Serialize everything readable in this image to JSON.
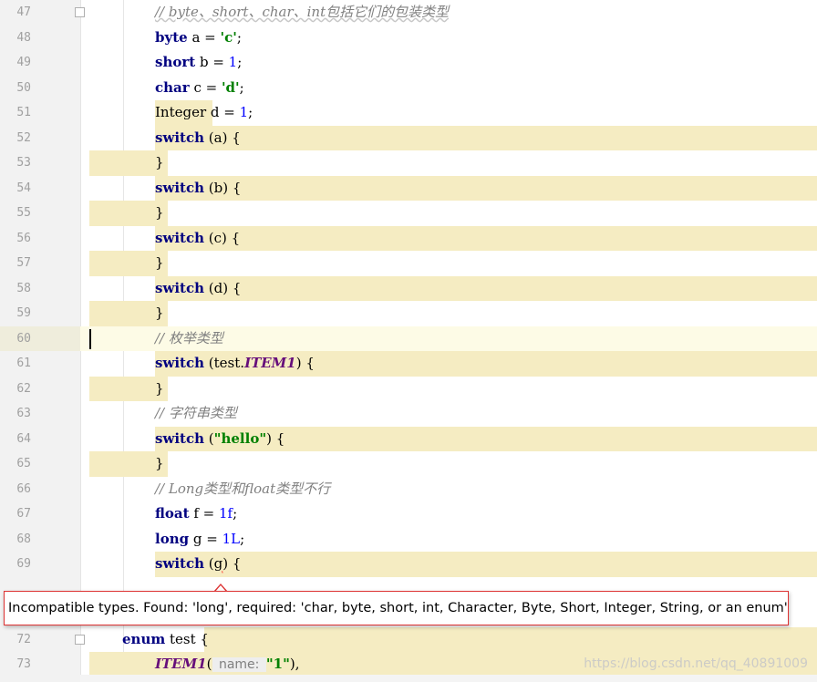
{
  "editor": {
    "lines": [
      {
        "num": "47",
        "tokens": [
          {
            "t": "// byte、short、char、int包括它们的包装类型",
            "c": "cm cm-u"
          }
        ]
      },
      {
        "num": "48",
        "tokens": [
          {
            "t": "byte",
            "c": "kw"
          },
          {
            "t": " a = ",
            "c": ""
          },
          {
            "t": "'c'",
            "c": "str"
          },
          {
            "t": ";",
            "c": ""
          }
        ]
      },
      {
        "num": "49",
        "tokens": [
          {
            "t": "short",
            "c": "kw"
          },
          {
            "t": " b = ",
            "c": ""
          },
          {
            "t": "1",
            "c": "num"
          },
          {
            "t": ";",
            "c": ""
          }
        ]
      },
      {
        "num": "50",
        "tokens": [
          {
            "t": "char",
            "c": "kw"
          },
          {
            "t": " c = ",
            "c": ""
          },
          {
            "t": "'d'",
            "c": "str"
          },
          {
            "t": ";",
            "c": ""
          }
        ]
      },
      {
        "num": "51",
        "tokens": [
          {
            "t": "Integer",
            "c": ""
          },
          {
            "t": " d = ",
            "c": ""
          },
          {
            "t": "1",
            "c": "num"
          },
          {
            "t": ";",
            "c": ""
          }
        ]
      },
      {
        "num": "52",
        "tokens": [
          {
            "t": "switch",
            "c": "kw"
          },
          {
            "t": " (a) {",
            "c": ""
          }
        ]
      },
      {
        "num": "53",
        "tokens": [
          {
            "t": "}",
            "c": ""
          }
        ]
      },
      {
        "num": "54",
        "tokens": [
          {
            "t": "switch",
            "c": "kw"
          },
          {
            "t": " (b) {",
            "c": ""
          }
        ]
      },
      {
        "num": "55",
        "tokens": [
          {
            "t": "}",
            "c": ""
          }
        ]
      },
      {
        "num": "56",
        "tokens": [
          {
            "t": "switch",
            "c": "kw"
          },
          {
            "t": " (c) {",
            "c": ""
          }
        ]
      },
      {
        "num": "57",
        "tokens": [
          {
            "t": "}",
            "c": ""
          }
        ]
      },
      {
        "num": "58",
        "tokens": [
          {
            "t": "switch",
            "c": "kw"
          },
          {
            "t": " (d) {",
            "c": ""
          }
        ]
      },
      {
        "num": "59",
        "tokens": [
          {
            "t": "}",
            "c": ""
          }
        ]
      },
      {
        "num": "60",
        "tokens": [
          {
            "t": "// 枚举类型",
            "c": "cm"
          }
        ]
      },
      {
        "num": "61",
        "tokens": [
          {
            "t": "switch",
            "c": "kw"
          },
          {
            "t": " (test.",
            "c": ""
          },
          {
            "t": "ITEM1",
            "c": "const"
          },
          {
            "t": ") {",
            "c": ""
          }
        ]
      },
      {
        "num": "62",
        "tokens": [
          {
            "t": "}",
            "c": ""
          }
        ]
      },
      {
        "num": "63",
        "tokens": [
          {
            "t": "// 字符串类型",
            "c": "cm"
          }
        ]
      },
      {
        "num": "64",
        "tokens": [
          {
            "t": "switch",
            "c": "kw"
          },
          {
            "t": " (",
            "c": ""
          },
          {
            "t": "\"hello\"",
            "c": "str"
          },
          {
            "t": ") {",
            "c": ""
          }
        ]
      },
      {
        "num": "65",
        "tokens": [
          {
            "t": "}",
            "c": ""
          }
        ]
      },
      {
        "num": "66",
        "tokens": [
          {
            "t": "// Long类型和float类型不行",
            "c": "cm"
          }
        ]
      },
      {
        "num": "67",
        "tokens": [
          {
            "t": "float",
            "c": "kw"
          },
          {
            "t": " f = ",
            "c": ""
          },
          {
            "t": "1f",
            "c": "num"
          },
          {
            "t": ";",
            "c": ""
          }
        ]
      },
      {
        "num": "68",
        "tokens": [
          {
            "t": "long",
            "c": "kw"
          },
          {
            "t": " g = ",
            "c": ""
          },
          {
            "t": "1L",
            "c": "num"
          },
          {
            "t": ";",
            "c": ""
          }
        ]
      },
      {
        "num": "69",
        "tokens": [
          {
            "t": "switch",
            "c": "kw"
          },
          {
            "t": " (",
            "c": ""
          },
          {
            "t": "g",
            "c": "var-err"
          },
          {
            "t": ") {",
            "c": ""
          }
        ]
      },
      {
        "num": "72",
        "tokens": [
          {
            "t": "enum",
            "c": "kw"
          },
          {
            "t": " test {",
            "c": ""
          }
        ]
      },
      {
        "num": "73",
        "tokens": [
          {
            "t": "ITEM1",
            "c": "const"
          },
          {
            "t": "(",
            "c": ""
          },
          {
            "t": " name: ",
            "c": "hint"
          },
          {
            "t": "\"1\"",
            "c": "str"
          },
          {
            "t": "),",
            "c": ""
          }
        ]
      }
    ]
  },
  "tooltip": {
    "message": "Incompatible types. Found: 'long', required: 'char, byte, short, int, Character, Byte, Short, Integer, String, or an enum'"
  },
  "watermark": "https://blog.csdn.net/qq_40891009",
  "colors": {
    "highlight": "#f5ecc2",
    "keyword": "#000080",
    "string": "#008000",
    "number": "#0000ff",
    "comment": "#808080",
    "error": "#ff0000"
  }
}
